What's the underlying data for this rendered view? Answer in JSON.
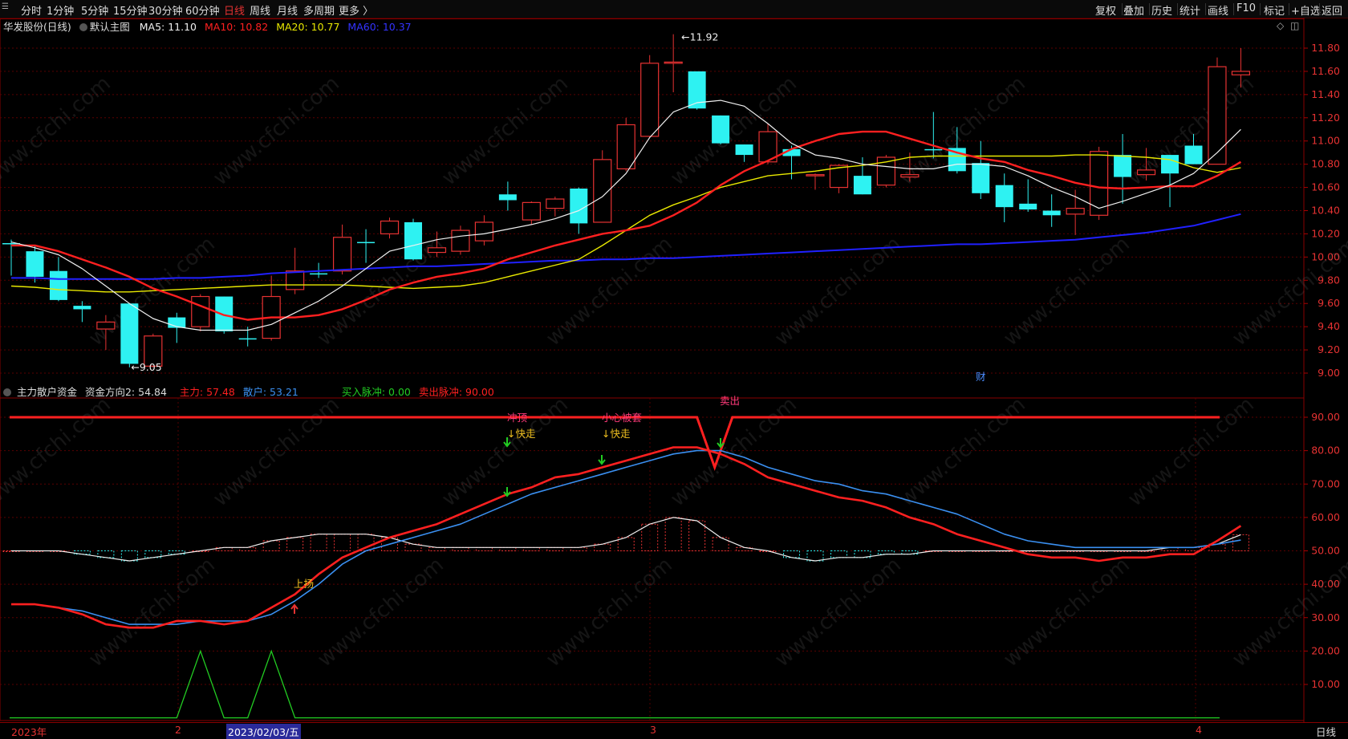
{
  "toolbar": {
    "logo": "☰",
    "periods": [
      "分时",
      "1分钟",
      "5分钟",
      "15分钟",
      "30分钟",
      "60分钟",
      "日线",
      "周线",
      "月线",
      "多周期",
      "更多 〉"
    ],
    "active_period": "日线",
    "right_tools": [
      "复权",
      "叠加",
      "历史",
      "统计",
      "画线",
      "F10",
      "标记",
      "+自选",
      "返回"
    ]
  },
  "main_header": {
    "stock": "华发股份(日线)",
    "template": "默认主图",
    "ma5": "MA5: 11.10",
    "ma10": "MA10: 10.82",
    "ma20": "MA20: 10.77",
    "ma60": "MA60: 10.37"
  },
  "sub_header": {
    "name": "主力散户资金",
    "dir": "资金方向2: 54.84",
    "main": "主力: 57.48",
    "retail": "散户: 53.21",
    "buy": "买入脉冲: 0.00",
    "sell": "卖出脉冲: 90.00"
  },
  "colors": {
    "up": "#e63232",
    "down": "#2ef2f2",
    "ma5": "#f0f0f0",
    "ma10": "#ff2020",
    "ma20": "#e8e800",
    "ma60": "#2020ff",
    "grid": "#5a0000",
    "main_line": "#ff2020",
    "retail_line": "#3a8ff0",
    "buy_line": "#22cc22",
    "label_yellow": "#f0c020",
    "label_pink": "#ff3a7a"
  },
  "price_axis": [
    "11.80",
    "11.60",
    "11.40",
    "11.20",
    "11.00",
    "10.80",
    "10.60",
    "10.40",
    "10.20",
    "10.00",
    "9.80",
    "9.60",
    "9.40",
    "9.20",
    "9.00"
  ],
  "sub_axis": [
    "90.00",
    "80.00",
    "70.00",
    "60.00",
    "50.00",
    "40.00",
    "30.00",
    "20.00",
    "10.00"
  ],
  "price_annotations": {
    "high": "11.92",
    "low": "9.05",
    "marker": "财"
  },
  "indicator_labels": {
    "rise": "上扬",
    "top": "冲顶",
    "careful": "小心被套",
    "quick1": "↓快走",
    "quick2": "↓快走",
    "sell_top": "卖出"
  },
  "date_axis": {
    "start": "2023年",
    "m2": "2",
    "selected": "2023/02/03/五",
    "m3": "3",
    "m4": "4",
    "period_label": "日线"
  },
  "chart_data": {
    "type": "candlestick",
    "title": "华发股份(日线)",
    "ylim": [
      9.0,
      11.9
    ],
    "candles": [
      {
        "o": 10.12,
        "h": 10.15,
        "l": 9.84,
        "c": 10.12
      },
      {
        "o": 10.05,
        "h": 10.1,
        "l": 9.78,
        "c": 9.83
      },
      {
        "o": 9.88,
        "h": 10.0,
        "l": 9.62,
        "c": 9.63
      },
      {
        "o": 9.58,
        "h": 9.62,
        "l": 9.44,
        "c": 9.55
      },
      {
        "o": 9.38,
        "h": 9.5,
        "l": 9.2,
        "c": 9.44
      },
      {
        "o": 9.6,
        "h": 9.6,
        "l": 9.05,
        "c": 9.08
      },
      {
        "o": 9.06,
        "h": 9.34,
        "l": 9.05,
        "c": 9.32
      },
      {
        "o": 9.48,
        "h": 9.52,
        "l": 9.26,
        "c": 9.39
      },
      {
        "o": 9.4,
        "h": 9.68,
        "l": 9.36,
        "c": 9.66
      },
      {
        "o": 9.66,
        "h": 9.66,
        "l": 9.34,
        "c": 9.36
      },
      {
        "o": 9.3,
        "h": 9.4,
        "l": 9.23,
        "c": 9.3
      },
      {
        "o": 9.3,
        "h": 9.84,
        "l": 9.28,
        "c": 9.66
      },
      {
        "o": 9.72,
        "h": 10.08,
        "l": 9.68,
        "c": 9.88
      },
      {
        "o": 9.86,
        "h": 9.95,
        "l": 9.82,
        "c": 9.86
      },
      {
        "o": 9.88,
        "h": 10.28,
        "l": 9.85,
        "c": 10.17
      },
      {
        "o": 10.13,
        "h": 10.24,
        "l": 9.95,
        "c": 10.13
      },
      {
        "o": 10.2,
        "h": 10.34,
        "l": 10.16,
        "c": 10.31
      },
      {
        "o": 10.3,
        "h": 10.33,
        "l": 9.97,
        "c": 9.98
      },
      {
        "o": 10.04,
        "h": 10.22,
        "l": 10.0,
        "c": 10.08
      },
      {
        "o": 10.05,
        "h": 10.27,
        "l": 10.02,
        "c": 10.23
      },
      {
        "o": 10.14,
        "h": 10.36,
        "l": 10.1,
        "c": 10.3
      },
      {
        "o": 10.54,
        "h": 10.65,
        "l": 10.4,
        "c": 10.49
      },
      {
        "o": 10.32,
        "h": 10.48,
        "l": 10.28,
        "c": 10.47
      },
      {
        "o": 10.42,
        "h": 10.52,
        "l": 10.35,
        "c": 10.5
      },
      {
        "o": 10.59,
        "h": 10.6,
        "l": 10.2,
        "c": 10.29
      },
      {
        "o": 10.3,
        "h": 10.92,
        "l": 10.3,
        "c": 10.84
      },
      {
        "o": 10.76,
        "h": 11.2,
        "l": 10.74,
        "c": 11.14
      },
      {
        "o": 11.04,
        "h": 11.74,
        "l": 11.03,
        "c": 11.67
      },
      {
        "o": 11.67,
        "h": 11.92,
        "l": 11.42,
        "c": 11.68
      },
      {
        "o": 11.6,
        "h": 11.6,
        "l": 11.27,
        "c": 11.28
      },
      {
        "o": 11.22,
        "h": 11.22,
        "l": 10.97,
        "c": 10.98
      },
      {
        "o": 10.97,
        "h": 10.97,
        "l": 10.82,
        "c": 10.88
      },
      {
        "o": 10.82,
        "h": 11.15,
        "l": 10.8,
        "c": 11.08
      },
      {
        "o": 10.93,
        "h": 10.96,
        "l": 10.67,
        "c": 10.87
      },
      {
        "o": 10.7,
        "h": 10.72,
        "l": 10.58,
        "c": 10.71
      },
      {
        "o": 10.6,
        "h": 10.8,
        "l": 10.55,
        "c": 10.79
      },
      {
        "o": 10.7,
        "h": 10.86,
        "l": 10.54,
        "c": 10.54
      },
      {
        "o": 10.62,
        "h": 10.88,
        "l": 10.6,
        "c": 10.86
      },
      {
        "o": 10.69,
        "h": 10.9,
        "l": 10.65,
        "c": 10.71
      },
      {
        "o": 10.93,
        "h": 11.25,
        "l": 10.85,
        "c": 10.93
      },
      {
        "o": 10.94,
        "h": 11.12,
        "l": 10.72,
        "c": 10.74
      },
      {
        "o": 10.81,
        "h": 11.0,
        "l": 10.5,
        "c": 10.55
      },
      {
        "o": 10.62,
        "h": 10.72,
        "l": 10.3,
        "c": 10.43
      },
      {
        "o": 10.46,
        "h": 10.67,
        "l": 10.39,
        "c": 10.41
      },
      {
        "o": 10.4,
        "h": 10.54,
        "l": 10.26,
        "c": 10.36
      },
      {
        "o": 10.37,
        "h": 10.58,
        "l": 10.19,
        "c": 10.42
      },
      {
        "o": 10.36,
        "h": 10.95,
        "l": 10.32,
        "c": 10.91
      },
      {
        "o": 10.88,
        "h": 11.06,
        "l": 10.46,
        "c": 10.69
      },
      {
        "o": 10.71,
        "h": 10.94,
        "l": 10.66,
        "c": 10.75
      },
      {
        "o": 10.88,
        "h": 10.88,
        "l": 10.43,
        "c": 10.72
      },
      {
        "o": 10.96,
        "h": 11.06,
        "l": 10.8,
        "c": 10.8
      },
      {
        "o": 10.8,
        "h": 11.72,
        "l": 10.8,
        "c": 11.64
      },
      {
        "o": 11.57,
        "h": 11.8,
        "l": 11.46,
        "c": 11.6
      }
    ],
    "ma5": [
      10.13,
      10.08,
      10.02,
      9.9,
      9.75,
      9.6,
      9.47,
      9.4,
      9.37,
      9.37,
      9.37,
      9.42,
      9.52,
      9.62,
      9.75,
      9.9,
      10.05,
      10.1,
      10.15,
      10.18,
      10.2,
      10.24,
      10.28,
      10.33,
      10.4,
      10.52,
      10.72,
      11.03,
      11.25,
      11.33,
      11.35,
      11.3,
      11.15,
      10.98,
      10.88,
      10.85,
      10.8,
      10.78,
      10.76,
      10.76,
      10.8,
      10.8,
      10.78,
      10.7,
      10.6,
      10.52,
      10.42,
      10.48,
      10.55,
      10.62,
      10.72,
      10.9,
      11.1
    ],
    "ma10": [
      10.1,
      10.1,
      10.05,
      9.98,
      9.91,
      9.83,
      9.73,
      9.66,
      9.58,
      9.5,
      9.46,
      9.48,
      9.48,
      9.5,
      9.55,
      9.63,
      9.72,
      9.78,
      9.83,
      9.86,
      9.9,
      9.98,
      10.04,
      10.1,
      10.15,
      10.2,
      10.23,
      10.27,
      10.36,
      10.47,
      10.62,
      10.74,
      10.83,
      10.93,
      11.0,
      11.06,
      11.08,
      11.08,
      11.02,
      10.96,
      10.9,
      10.85,
      10.82,
      10.75,
      10.7,
      10.64,
      10.6,
      10.59,
      10.6,
      10.61,
      10.61,
      10.7,
      10.82
    ],
    "ma20": [
      9.75,
      9.74,
      9.72,
      9.71,
      9.7,
      9.7,
      9.71,
      9.72,
      9.73,
      9.74,
      9.75,
      9.76,
      9.76,
      9.76,
      9.76,
      9.75,
      9.74,
      9.73,
      9.74,
      9.75,
      9.78,
      9.83,
      9.88,
      9.93,
      9.98,
      10.1,
      10.23,
      10.36,
      10.45,
      10.52,
      10.6,
      10.65,
      10.7,
      10.72,
      10.74,
      10.77,
      10.79,
      10.82,
      10.86,
      10.87,
      10.87,
      10.87,
      10.87,
      10.87,
      10.87,
      10.88,
      10.88,
      10.87,
      10.86,
      10.84,
      10.77,
      10.73,
      10.77
    ],
    "ma60": [
      9.82,
      9.82,
      9.81,
      9.81,
      9.81,
      9.81,
      9.81,
      9.82,
      9.82,
      9.83,
      9.84,
      9.86,
      9.87,
      9.88,
      9.89,
      9.9,
      9.91,
      9.92,
      9.92,
      9.93,
      9.94,
      9.95,
      9.96,
      9.97,
      9.97,
      9.98,
      9.98,
      9.99,
      9.99,
      10.0,
      10.01,
      10.02,
      10.03,
      10.04,
      10.05,
      10.06,
      10.07,
      10.08,
      10.09,
      10.1,
      10.11,
      10.11,
      10.12,
      10.13,
      10.14,
      10.15,
      10.17,
      10.19,
      10.21,
      10.24,
      10.27,
      10.32,
      10.37
    ],
    "sub_ylim": [
      0,
      100
    ],
    "main_fund": [
      34,
      34,
      33,
      31,
      28,
      27,
      27,
      29,
      29,
      28,
      29,
      33,
      37,
      43,
      48,
      51,
      54,
      56,
      58,
      61,
      64,
      67,
      69,
      72,
      73,
      75,
      77,
      79,
      81,
      81,
      79,
      76,
      72,
      70,
      68,
      66,
      65,
      63,
      60,
      58,
      55,
      53,
      51,
      49,
      48,
      48,
      47,
      48,
      48,
      49,
      49,
      53,
      57.48
    ],
    "retail_fund": [
      34,
      34,
      33,
      32,
      30,
      28,
      28,
      28,
      29,
      29,
      29,
      31,
      35,
      40,
      46,
      50,
      52,
      54,
      56,
      58,
      61,
      64,
      67,
      69,
      71,
      73,
      75,
      77,
      79,
      80,
      80,
      78,
      75,
      73,
      71,
      70,
      68,
      67,
      65,
      63,
      61,
      58,
      55,
      53,
      52,
      51,
      51,
      51,
      51,
      51,
      51,
      52,
      53.21
    ],
    "direction": [
      50,
      50,
      50,
      49,
      48,
      47,
      48,
      49,
      50,
      51,
      51,
      53,
      54,
      55,
      55,
      55,
      54,
      52,
      51,
      51,
      51,
      51,
      51,
      51,
      51,
      52,
      54,
      58,
      60,
      59,
      54,
      51,
      50,
      48,
      47,
      48,
      48,
      49,
      49,
      50,
      50,
      50,
      50,
      50,
      50,
      50,
      50,
      50,
      50,
      51,
      51,
      52,
      54.84
    ],
    "sell_pulse_dip_index": 30,
    "buy_pulse_peaks": [
      8,
      11
    ]
  }
}
